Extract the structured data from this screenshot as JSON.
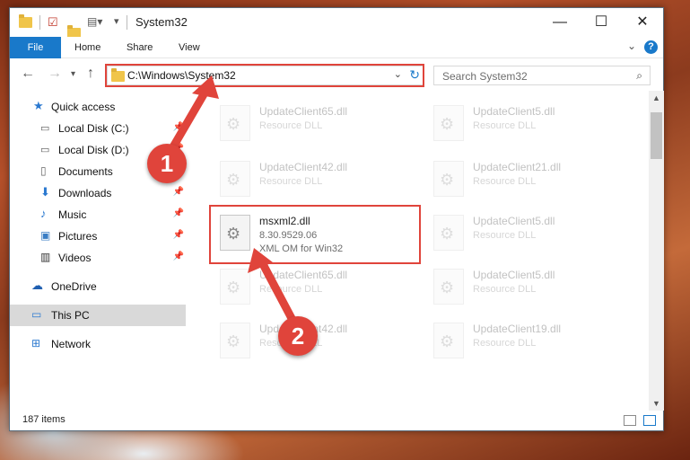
{
  "window": {
    "title": "System32"
  },
  "controls": {
    "minimize": "—",
    "maximize": "☐",
    "close": "✕"
  },
  "ribbon": {
    "tabs": [
      "File",
      "Home",
      "Share",
      "View"
    ],
    "help": "?"
  },
  "address": {
    "path": "C:\\Windows\\System32",
    "search_placeholder": "Search System32"
  },
  "sidebar": {
    "items": [
      {
        "label": "Quick access",
        "icon": "star-icon",
        "pinned": false
      },
      {
        "label": "Local Disk (C:)",
        "icon": "drive-icon",
        "pinned": true
      },
      {
        "label": "Local Disk (D:)",
        "icon": "drive-icon",
        "pinned": true
      },
      {
        "label": "Documents",
        "icon": "document-icon",
        "pinned": true
      },
      {
        "label": "Downloads",
        "icon": "download-icon",
        "pinned": true
      },
      {
        "label": "Music",
        "icon": "music-icon",
        "pinned": true
      },
      {
        "label": "Pictures",
        "icon": "picture-icon",
        "pinned": true
      },
      {
        "label": "Videos",
        "icon": "video-icon",
        "pinned": true
      },
      {
        "label": "OneDrive",
        "icon": "cloud-icon",
        "pinned": false
      },
      {
        "label": "This PC",
        "icon": "computer-icon",
        "pinned": false,
        "selected": true
      },
      {
        "label": "Network",
        "icon": "network-icon",
        "pinned": false
      }
    ]
  },
  "files": [
    {
      "name": "UpdateClient65.dll",
      "desc": "Resource DLL",
      "faded": true
    },
    {
      "name": "UpdateClient5.dll",
      "desc": "Resource DLL",
      "faded": true
    },
    {
      "name": "UpdateClient42.dll",
      "desc": "Resource DLL",
      "faded": true
    },
    {
      "name": "UpdateClient21.dll",
      "desc": "Resource DLL",
      "faded": true
    },
    {
      "name": "msxml2.dll",
      "desc": "8.30.9529.06",
      "desc2": "XML OM for Win32",
      "faded": false
    },
    {
      "name": "UpdateClient5.dll",
      "desc": "Resource DLL",
      "faded": true
    },
    {
      "name": "UpdateClient65.dll",
      "desc": "Resource DLL",
      "faded": true
    },
    {
      "name": "UpdateClient5.dll",
      "desc": "Resource DLL",
      "faded": true
    },
    {
      "name": "UpdateClient42.dll",
      "desc": "Resource DLL",
      "faded": true
    },
    {
      "name": "UpdateClient19.dll",
      "desc": "Resource DLL",
      "faded": true
    }
  ],
  "status": {
    "count": "187 items"
  },
  "annotations": {
    "step1": "1",
    "step2": "2",
    "color": "#e0443b"
  }
}
